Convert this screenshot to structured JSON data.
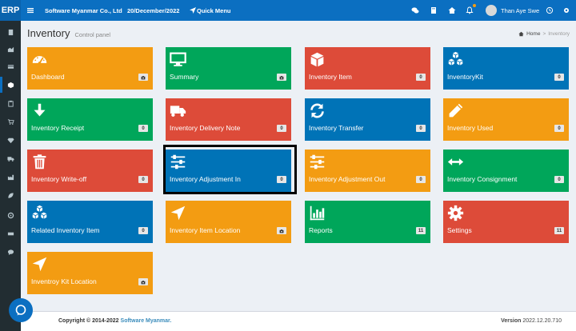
{
  "topbar": {
    "logo": "ERP",
    "company": "Software Myanmar Co., Ltd",
    "date": "20/December/2022",
    "quick_menu": "Quick Menu",
    "user_name": "Than Aye Swe"
  },
  "header": {
    "title": "Inventory",
    "subtitle": "Control panel",
    "breadcrumb_home": "Home",
    "breadcrumb_sep": ">",
    "breadcrumb_current": "Inventory"
  },
  "tiles": [
    {
      "label": "Dashboard",
      "badge": "",
      "icon": "dashboard-gauge-icon",
      "color": "#f39c12"
    },
    {
      "label": "Summary",
      "badge": "",
      "icon": "monitor-icon",
      "color": "#00a65a"
    },
    {
      "label": "Inventory Item",
      "badge": "0",
      "icon": "cube-icon",
      "color": "#dd4b39"
    },
    {
      "label": "InventoryKit",
      "badge": "0",
      "icon": "cubes-icon",
      "color": "#0073b7"
    },
    {
      "label": "Inventory Receipt",
      "badge": "0",
      "icon": "arrow-down-icon",
      "color": "#00a65a"
    },
    {
      "label": "Inventory Delivery Note",
      "badge": "0",
      "icon": "truck-icon",
      "color": "#dd4b39"
    },
    {
      "label": "Inventory Transfer",
      "badge": "0",
      "icon": "refresh-icon",
      "color": "#0073b7"
    },
    {
      "label": "Inventory Used",
      "badge": "0",
      "icon": "pencil-icon",
      "color": "#f39c12"
    },
    {
      "label": "Inventory Write-off",
      "badge": "0",
      "icon": "trash-icon",
      "color": "#dd4b39"
    },
    {
      "label": "Inventory Adjustment In",
      "badge": "0",
      "icon": "sliders-icon",
      "color": "#0073b7"
    },
    {
      "label": "Inventory Adjustment Out",
      "badge": "0",
      "icon": "sliders-icon",
      "color": "#f39c12"
    },
    {
      "label": "Inventory Consignment",
      "badge": "0",
      "icon": "arrows-horizontal-icon",
      "color": "#00a65a"
    },
    {
      "label": "Related Inventory Item",
      "badge": "0",
      "icon": "cubes-icon",
      "color": "#0073b7"
    },
    {
      "label": "Inventory Item Location",
      "badge": "",
      "icon": "location-arrow-icon",
      "color": "#f39c12"
    },
    {
      "label": "Reports",
      "badge": "11",
      "icon": "bar-chart-icon",
      "color": "#00a65a"
    },
    {
      "label": "Settings",
      "badge": "11",
      "icon": "gear-icon",
      "color": "#dd4b39"
    },
    {
      "label": "Inventroy Kit Location",
      "badge": "",
      "icon": "location-arrow-icon",
      "color": "#f39c12"
    }
  ],
  "footer": {
    "copyright": "Copyright © 2014-2022",
    "brand": "Software Myanmar.",
    "version_label": "Version",
    "version": "2022.12.20.710"
  }
}
